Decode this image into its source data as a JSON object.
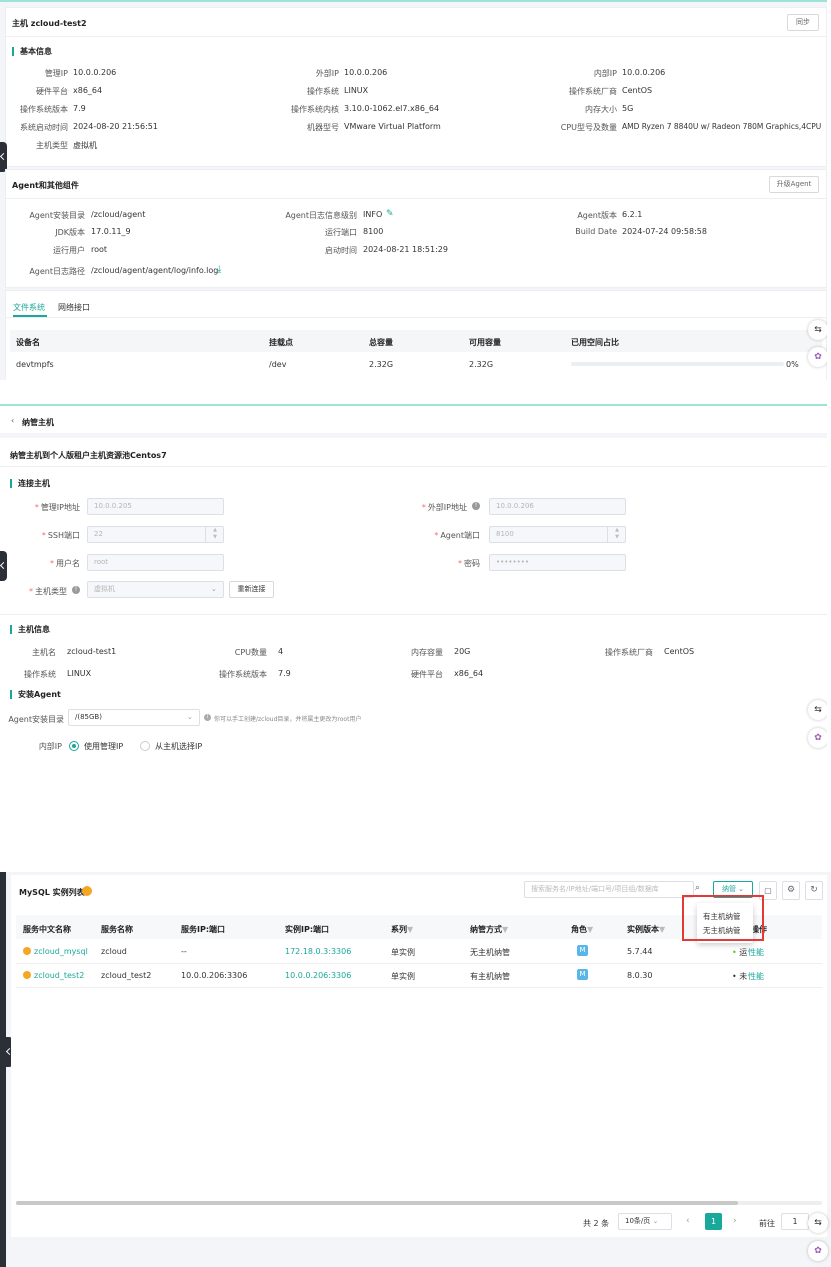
{
  "host_detail": {
    "title": "主机 zcloud-test2",
    "sync_button": "同步",
    "basic_section": "基本信息",
    "basic_fields": [
      {
        "label": "管理IP",
        "value": "10.0.0.206"
      },
      {
        "label": "外部IP",
        "value": "10.0.0.206"
      },
      {
        "label": "内部IP",
        "value": "10.0.0.206"
      },
      {
        "label": "硬件平台",
        "value": "x86_64"
      },
      {
        "label": "操作系统",
        "value": "LINUX"
      },
      {
        "label": "操作系统厂商",
        "value": "CentOS"
      },
      {
        "label": "操作系统版本",
        "value": "7.9"
      },
      {
        "label": "操作系统内核",
        "value": "3.10.0-1062.el7.x86_64"
      },
      {
        "label": "内存大小",
        "value": "5G"
      },
      {
        "label": "系统启动时间",
        "value": "2024-08-20 21:56:51"
      },
      {
        "label": "机器型号",
        "value": "VMware Virtual Platform"
      },
      {
        "label": "CPU型号及数量",
        "value": "AMD Ryzen 7 8840U w/ Radeon 780M Graphics,4CPU"
      },
      {
        "label": "主机类型",
        "value": "虚拟机"
      }
    ],
    "agent_section": "Agent和其他组件",
    "upgrade_button": "升级Agent",
    "agent_fields": [
      {
        "label": "Agent安装目录",
        "value": "/zcloud/agent"
      },
      {
        "label": "Agent日志信息级别",
        "value": "INFO"
      },
      {
        "label": "Agent版本",
        "value": "6.2.1"
      },
      {
        "label": "JDK版本",
        "value": "17.0.11_9"
      },
      {
        "label": "运行端口",
        "value": "8100"
      },
      {
        "label": "Build Date",
        "value": "2024-07-24 09:58:58"
      },
      {
        "label": "运行用户",
        "value": "root"
      },
      {
        "label": "启动时间",
        "value": "2024-08-21 18:51:29"
      },
      {
        "label": "Agent日志路径",
        "value": "/zcloud/agent/agent/log/info.log"
      }
    ],
    "tabs": [
      "文件系统",
      "网络接口"
    ],
    "fs_headers": [
      "设备名",
      "挂载点",
      "总容量",
      "可用容量",
      "已用空间占比"
    ],
    "fs_rows": [
      {
        "device": "devtmpfs",
        "mount": "/dev",
        "total": "2.32G",
        "free": "2.32G",
        "used_pct": "0%",
        "used_fraction": 0
      }
    ]
  },
  "manage_host": {
    "back_label": "纳管主机",
    "subtitle": "纳管主机到个人版租户主机资源池Centos7",
    "connect_section": "连接主机",
    "fields": {
      "mgmt_ip": {
        "label": "管理IP地址",
        "value": "10.0.0.205"
      },
      "external_ip": {
        "label": "外部IP地址",
        "value": "10.0.0.206"
      },
      "ssh_port": {
        "label": "SSH端口",
        "value": "22"
      },
      "agent_port": {
        "label": "Agent端口",
        "value": "8100"
      },
      "username": {
        "label": "用户名",
        "value": "root"
      },
      "password": {
        "label": "密码",
        "value": "••••••••"
      },
      "host_type": {
        "label": "主机类型",
        "value": "虚拟机"
      }
    },
    "reconnect_button": "重新连接",
    "info_section": "主机信息",
    "info_fields": [
      {
        "label": "主机名",
        "value": "zcloud-test1"
      },
      {
        "label": "CPU数量",
        "value": "4"
      },
      {
        "label": "内存容量",
        "value": "20G"
      },
      {
        "label": "操作系统厂商",
        "value": "CentOS"
      },
      {
        "label": "操作系统",
        "value": "LINUX"
      },
      {
        "label": "操作系统版本",
        "value": "7.9"
      },
      {
        "label": "硬件平台",
        "value": "x86_64"
      }
    ],
    "install_section": "安装Agent",
    "install_dir_label": "Agent安装目录",
    "install_dir_value": "/(85GB)",
    "install_hint": "你可以手工创建/zcloud目录，并将属主更改为root用户",
    "inner_ip_label": "内部IP",
    "radio_options": [
      "使用管理IP",
      "从主机选择IP"
    ]
  },
  "mysql_list": {
    "title": "MySQL 实例列表",
    "search_placeholder": "搜索服务名/IP地址/端口号/项目组/数据库",
    "filter_label": "纳管",
    "dropdown_options": [
      "有主机纳管",
      "无主机纳管"
    ],
    "headers": [
      "服务中文名称",
      "服务名称",
      "服务IP:端口",
      "实例IP:端口",
      "系列",
      "纳管方式",
      "角色",
      "实例版本",
      "操作"
    ],
    "rows": [
      {
        "cn_name": "zcloud_mysql",
        "name": "zcloud",
        "service_ip": "--",
        "instance_ip": "172.18.0.3:3306",
        "series": "单实例",
        "manage": "无主机纳管",
        "role": "M",
        "version": "5.7.44",
        "status": "运",
        "action": "性能"
      },
      {
        "cn_name": "zcloud_test2",
        "name": "zcloud_test2",
        "service_ip": "10.0.0.206:3306",
        "instance_ip": "10.0.0.206:3306",
        "series": "单实例",
        "manage": "有主机纳管",
        "role": "M",
        "version": "8.0.30",
        "status": "未",
        "action": "性能"
      }
    ],
    "pagination": {
      "total": "共 2 条",
      "page_size": "10条/页",
      "current_page": "1",
      "goto_label": "前往",
      "goto_value": "1"
    }
  },
  "colors": {
    "accent": "#1aa89a",
    "highlight_box": "#e53935",
    "warning": "#f5a623"
  }
}
